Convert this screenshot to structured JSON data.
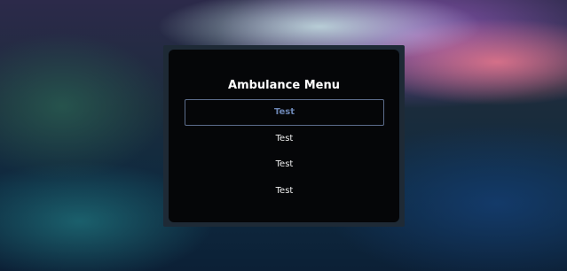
{
  "menu": {
    "title": "Ambulance Menu",
    "items": [
      {
        "label": "Test",
        "selected": true
      },
      {
        "label": "Test",
        "selected": false
      },
      {
        "label": "Test",
        "selected": false
      },
      {
        "label": "Test",
        "selected": false
      }
    ]
  },
  "colors": {
    "panel_border": "#1e2a36",
    "panel_background": "#050608",
    "selected_border": "#5c6d8c",
    "selected_text": "#6b85b3",
    "item_text": "#f0f0f0"
  }
}
